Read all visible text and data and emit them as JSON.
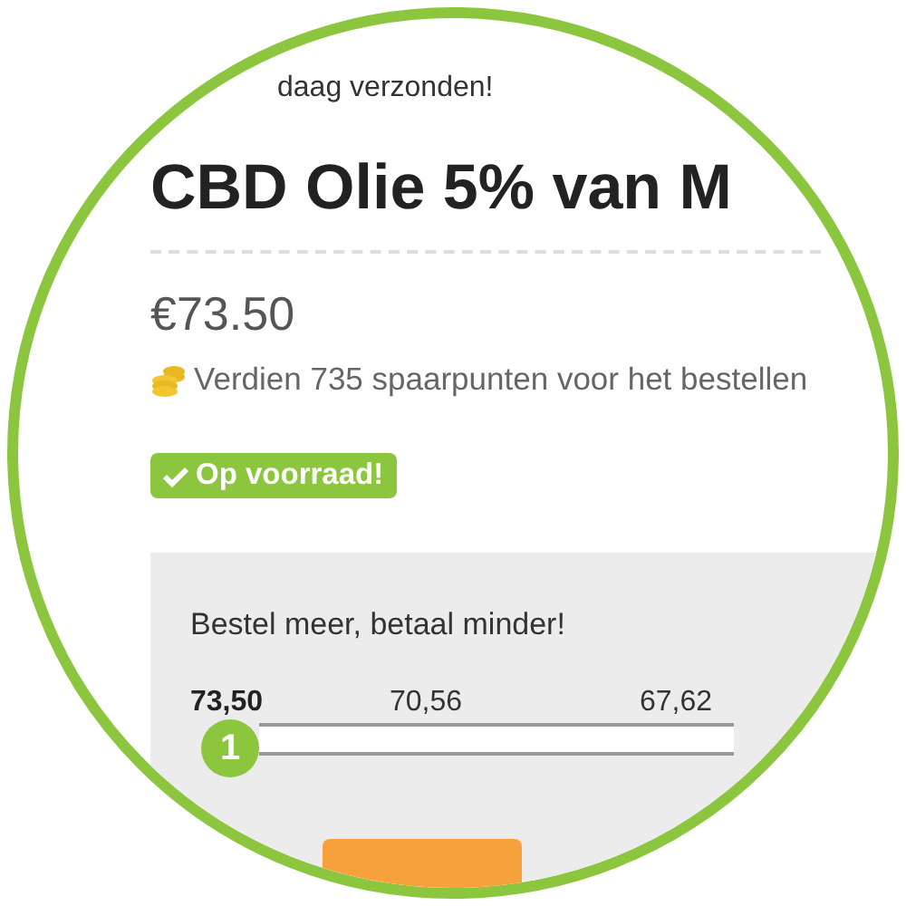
{
  "shipping_note": "daag verzonden!",
  "title": "CBD Olie 5% van M",
  "price": "€73.50",
  "points": "Verdien 735 spaarpunten voor het bestellen",
  "stock_badge": "Op voorraad!",
  "tier_panel": {
    "heading": "Bestel meer, betaal minder!",
    "tiers": [
      {
        "price": "73,50",
        "selected": true
      },
      {
        "price": "70,56",
        "selected": false
      },
      {
        "price": "67,62",
        "selected": false
      }
    ],
    "slider": {
      "level": 0,
      "thumb": "1"
    }
  }
}
